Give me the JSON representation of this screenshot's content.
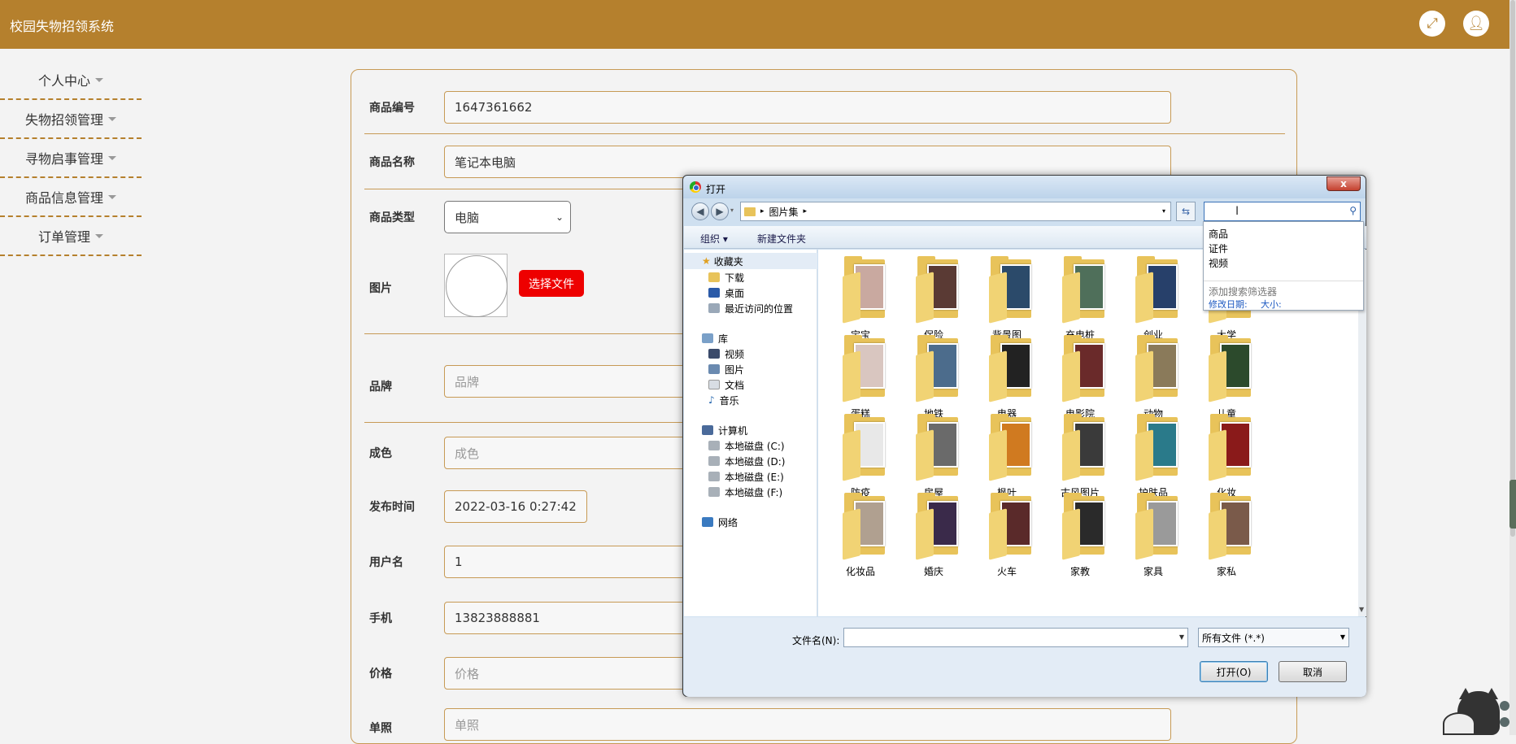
{
  "app": {
    "title": "校园失物招领系统"
  },
  "sidebar": {
    "items": [
      {
        "label": "个人中心"
      },
      {
        "label": "失物招领管理"
      },
      {
        "label": "寻物启事管理"
      },
      {
        "label": "商品信息管理"
      },
      {
        "label": "订单管理"
      }
    ]
  },
  "form": {
    "code": {
      "label": "商品编号",
      "value": "1647361662"
    },
    "name": {
      "label": "商品名称",
      "value": "笔记本电脑"
    },
    "type": {
      "label": "商品类型",
      "value": "电脑"
    },
    "image": {
      "label": "图片",
      "button": "选择文件"
    },
    "brand": {
      "label": "品牌",
      "placeholder": "品牌"
    },
    "condition": {
      "label": "成色",
      "placeholder": "成色"
    },
    "publish_time": {
      "label": "发布时间",
      "value": "2022-03-16 0:27:42"
    },
    "username": {
      "label": "用户名",
      "value": "1"
    },
    "phone": {
      "label": "手机",
      "value": "13823888881"
    },
    "price": {
      "label": "价格",
      "placeholder": "价格"
    },
    "photo": {
      "label": "单照",
      "placeholder": "单照"
    }
  },
  "dialog": {
    "title": "打开",
    "close": "x",
    "breadcrumb": "图片集",
    "toolbar": {
      "organize": "组织 ▾",
      "new_folder": "新建文件夹"
    },
    "nav": {
      "favorites": "收藏夹",
      "downloads": "下载",
      "desktop": "桌面",
      "recent": "最近访问的位置",
      "libraries": "库",
      "videos": "视频",
      "pictures": "图片",
      "documents": "文档",
      "music": "音乐",
      "computer": "计算机",
      "drive_c": "本地磁盘 (C:)",
      "drive_d": "本地磁盘 (D:)",
      "drive_e": "本地磁盘 (E:)",
      "drive_f": "本地磁盘 (F:)",
      "network": "网络"
    },
    "folders": [
      {
        "name": "宝宝",
        "color": "#c9a9a0"
      },
      {
        "name": "保险",
        "color": "#5a3a34"
      },
      {
        "name": "背景图",
        "color": "#2b4a6a"
      },
      {
        "name": "充电桩",
        "color": "#4f6f5a"
      },
      {
        "name": "创业",
        "color": "#27406a"
      },
      {
        "name": "大学",
        "color": "#26456f"
      },
      {
        "name": "蛋糕",
        "color": "#d9c6c0"
      },
      {
        "name": "地铁",
        "color": "#4c6c8c"
      },
      {
        "name": "电器",
        "color": "#222222"
      },
      {
        "name": "电影院",
        "color": "#6a2a2a"
      },
      {
        "name": "动物",
        "color": "#8a7a5a"
      },
      {
        "name": "儿童",
        "color": "#2c4a2c"
      },
      {
        "name": "防疫",
        "color": "#e8e8e8"
      },
      {
        "name": "房屋",
        "color": "#6a6a6a"
      },
      {
        "name": "枫叶",
        "color": "#d07a20"
      },
      {
        "name": "古风图片",
        "color": "#3a3a3a"
      },
      {
        "name": "护肤品",
        "color": "#2a7a8a"
      },
      {
        "name": "化妆",
        "color": "#8a1a1a"
      },
      {
        "name": "化妆品",
        "color": "#b0a090"
      },
      {
        "name": "婚庆",
        "color": "#3a2a4a"
      },
      {
        "name": "火车",
        "color": "#5a2a2a"
      },
      {
        "name": "家教",
        "color": "#2a2a2a"
      },
      {
        "name": "家具",
        "color": "#9a9a9a"
      },
      {
        "name": "家私",
        "color": "#7a5a4a"
      }
    ],
    "search_suggestions": [
      "商品",
      "证件",
      "视频"
    ],
    "search_hint": "添加搜索筛选器",
    "filter_date": "修改日期:",
    "filter_size": "大小:",
    "filename_label": "文件名(N):",
    "filetype": "所有文件 (*.*)",
    "open_button": "打开(O)",
    "cancel_button": "取消"
  }
}
